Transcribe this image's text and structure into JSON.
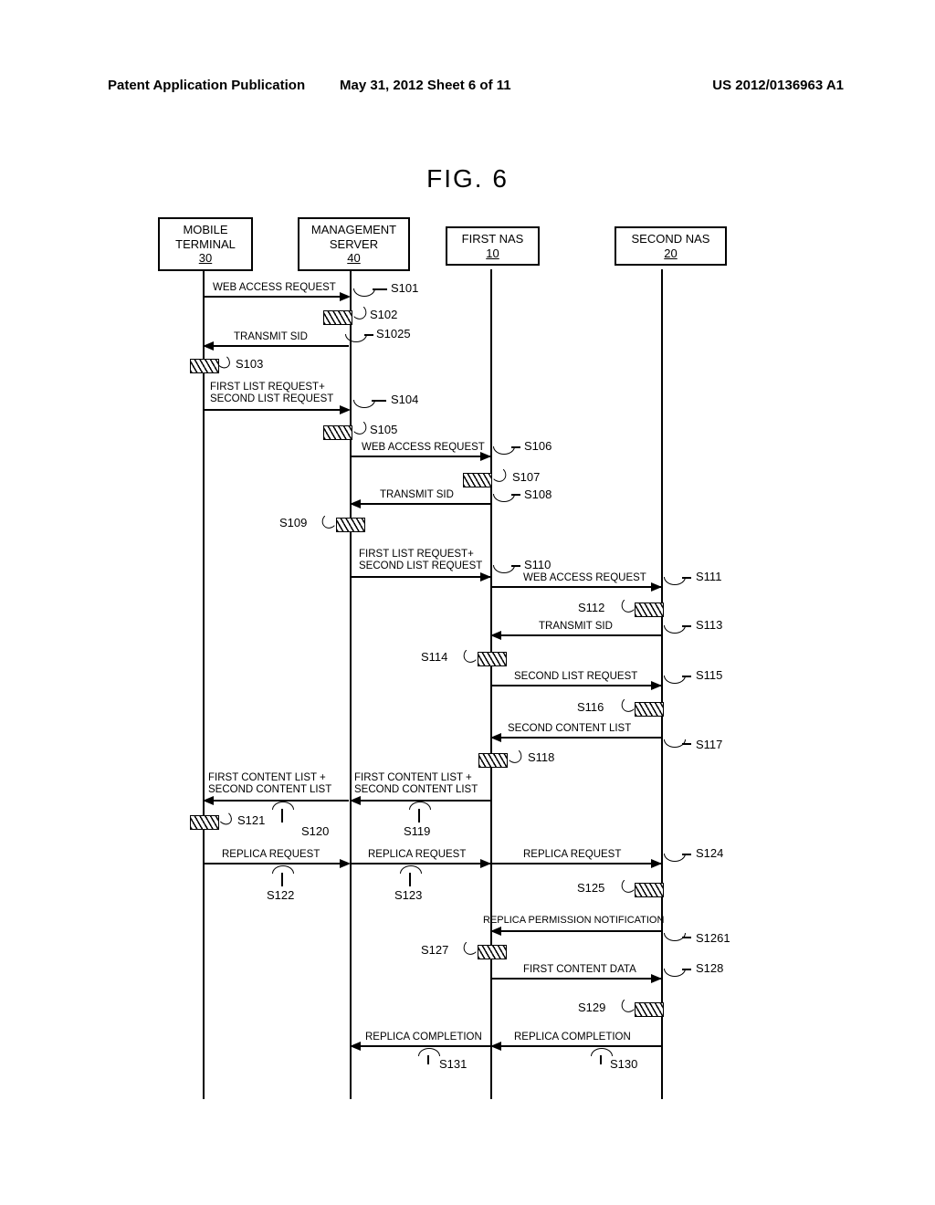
{
  "header": {
    "left": "Patent Application Publication",
    "center": "May 31, 2012  Sheet 6 of 11",
    "right": "US 2012/0136963 A1"
  },
  "figure_title": "FIG. 6",
  "actors": {
    "mobile": {
      "label": "MOBILE\nTERMINAL",
      "id": "30"
    },
    "server": {
      "label": "MANAGEMENT\nSERVER",
      "id": "40"
    },
    "nas1": {
      "label": "FIRST NAS",
      "id": "10"
    },
    "nas2": {
      "label": "SECOND NAS",
      "id": "20"
    }
  },
  "messages": {
    "m_s101": "WEB ACCESS REQUEST",
    "m_s1025": "TRANSMIT SID",
    "m_s104": "FIRST LIST REQUEST+\nSECOND LIST REQUEST",
    "m_s106": "WEB ACCESS REQUEST",
    "m_s108": "TRANSMIT SID",
    "m_s110": "FIRST LIST REQUEST+\nSECOND LIST REQUEST",
    "m_s111": "WEB ACCESS REQUEST",
    "m_s113": "TRANSMIT SID",
    "m_s115": "SECOND LIST REQUEST",
    "m_s117": "SECOND CONTENT LIST",
    "m_s119": "FIRST CONTENT LIST +\nSECOND CONTENT LIST",
    "m_s120": "FIRST CONTENT LIST +\nSECOND CONTENT LIST",
    "m_s122": "REPLICA REQUEST",
    "m_s123": "REPLICA REQUEST",
    "m_s124": "REPLICA REQUEST",
    "m_s1261": "REPLICA PERMISSION NOTIFICATION",
    "m_s128": "FIRST CONTENT DATA",
    "m_s130": "REPLICA COMPLETION",
    "m_s131": "REPLICA COMPLETION"
  },
  "steps": {
    "s101": "S101",
    "s102": "S102",
    "s1025": "S1025",
    "s103": "S103",
    "s104": "S104",
    "s105": "S105",
    "s106": "S106",
    "s107": "S107",
    "s108": "S108",
    "s109": "S109",
    "s110": "S110",
    "s111": "S111",
    "s112": "S112",
    "s113": "S113",
    "s114": "S114",
    "s115": "S115",
    "s116": "S116",
    "s117": "S117",
    "s118": "S118",
    "s119": "S119",
    "s120": "S120",
    "s121": "S121",
    "s122": "S122",
    "s123": "S123",
    "s124": "S124",
    "s125": "S125",
    "s1261": "S1261",
    "s127": "S127",
    "s128": "S128",
    "s129": "S129",
    "s130": "S130",
    "s131": "S131"
  }
}
